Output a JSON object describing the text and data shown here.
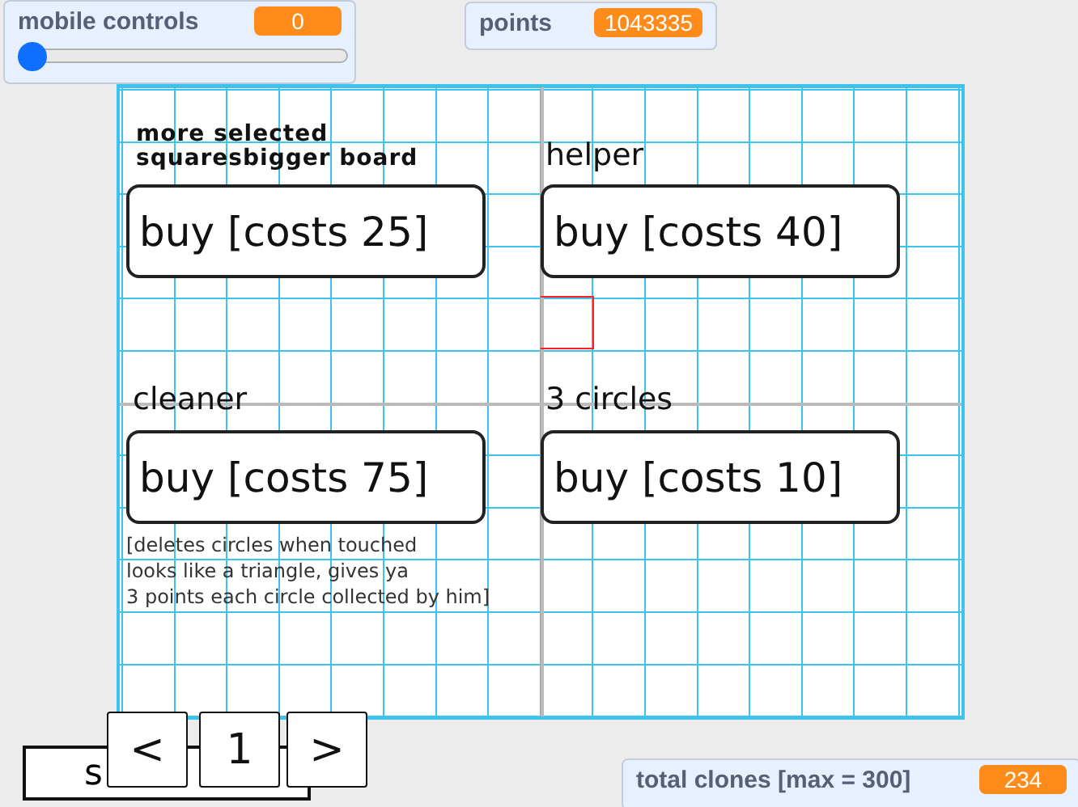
{
  "monitors": [
    {
      "kind": "slider",
      "label": "mobile controls",
      "value": "0",
      "level": 0
    },
    {
      "kind": "normal",
      "label": "points",
      "value": "1043335"
    },
    {
      "kind": "normal",
      "label": "total clones [max = 300]",
      "value": "234"
    }
  ],
  "stage": {
    "heading": "more selected squaresbigger board",
    "items": [
      {
        "label": "helper",
        "button": "buy [costs 40]"
      },
      {
        "label": "cleaner",
        "button": "buy [costs 75]"
      },
      {
        "label": "3 circles",
        "button": "buy [costs 10]"
      }
    ],
    "first_button": "buy [costs 25]",
    "description": "[deletes circles when touched\nlooks like a triangle, gives ya\n3 points each circle collected by him]",
    "shop_button": "s",
    "pager": [
      "<",
      "1",
      ">"
    ]
  }
}
